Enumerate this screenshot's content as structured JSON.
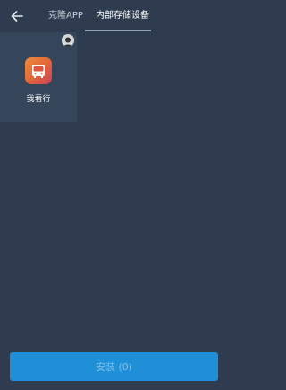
{
  "header": {
    "back_icon": "arrow-left-icon",
    "tabs": [
      {
        "label": "克隆APP",
        "active": false
      },
      {
        "label": "内部存储设备",
        "active": true
      }
    ]
  },
  "apps": [
    {
      "name": "我看行",
      "icon": "bus-icon",
      "icon_colors": [
        "#f08a3a",
        "#c9435a"
      ],
      "badge": "avatar"
    }
  ],
  "install_button": {
    "label": "安装 (0)",
    "color": "#1f8fd8"
  },
  "colors": {
    "background": "#2f3c4f",
    "card": "#35455a",
    "tab_indicator": "#8fa1b6"
  }
}
